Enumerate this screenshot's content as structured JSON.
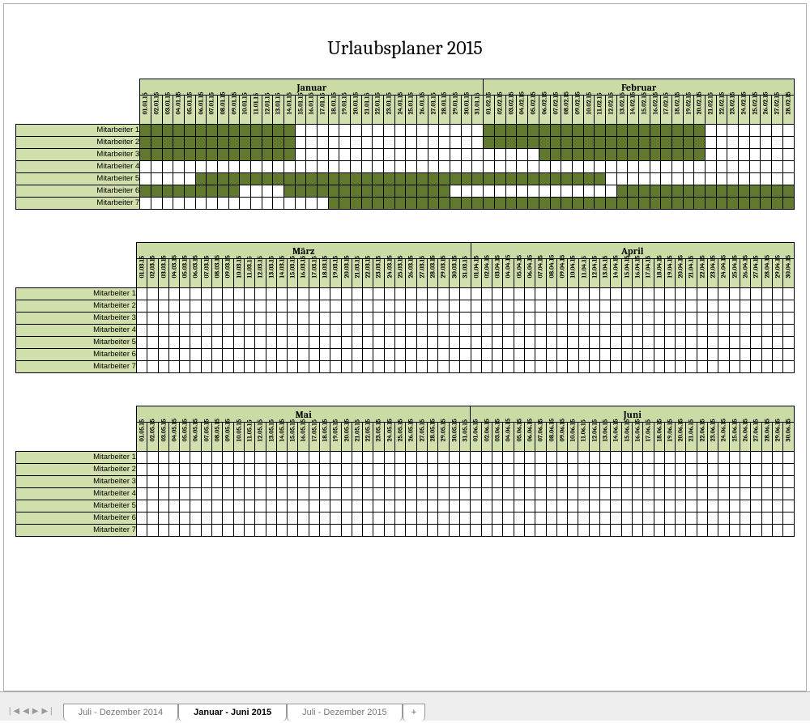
{
  "title": "Urlaubsplaner 2015",
  "employees": [
    "Mitarbeiter 1",
    "Mitarbeiter 2",
    "Mitarbeiter 3",
    "Mitarbeiter 4",
    "Mitarbeiter 5",
    "Mitarbeiter 6",
    "Mitarbeiter 7"
  ],
  "blocks": [
    {
      "months": [
        {
          "name": "Januar",
          "mm": "01",
          "yy": "15",
          "days": 31
        },
        {
          "name": "Februar",
          "mm": "02",
          "yy": "15",
          "days": 28
        }
      ],
      "filled": {
        "0": [
          1,
          2,
          3,
          4,
          5,
          6,
          7,
          8,
          9,
          10,
          11,
          12,
          13,
          14,
          32,
          33,
          34,
          35,
          36,
          37,
          38,
          39,
          40,
          41,
          42,
          43,
          44,
          45,
          46,
          47,
          48,
          49,
          50,
          51
        ],
        "1": [
          1,
          2,
          3,
          4,
          5,
          6,
          7,
          8,
          9,
          10,
          11,
          12,
          13,
          14,
          32,
          33,
          34,
          35,
          36,
          37,
          38,
          39,
          40,
          41,
          42,
          43,
          44,
          45,
          46,
          47,
          48,
          49,
          50,
          51
        ],
        "2": [
          1,
          2,
          3,
          4,
          5,
          6,
          7,
          8,
          9,
          10,
          11,
          12,
          13,
          14,
          37,
          38,
          39,
          40,
          41,
          42,
          43,
          44,
          45,
          46,
          47,
          48,
          49,
          50,
          51
        ],
        "3": [],
        "4": [
          6,
          7,
          8,
          9,
          10,
          11,
          12,
          13,
          14,
          15,
          16,
          17,
          18,
          19,
          20,
          21,
          22,
          23,
          24,
          25,
          26,
          27,
          28,
          29,
          30,
          31,
          32,
          33,
          34,
          35,
          36,
          37,
          38,
          39,
          40,
          41,
          42
        ],
        "5": [
          1,
          2,
          3,
          4,
          5,
          6,
          7,
          8,
          9,
          14,
          15,
          16,
          17,
          18,
          19,
          20,
          21,
          22,
          23,
          24,
          25,
          26,
          27,
          28,
          44,
          45,
          46,
          47,
          48,
          49,
          50,
          51,
          52,
          53,
          54,
          55,
          56,
          57,
          58,
          59
        ],
        "6": [
          18,
          19,
          20,
          21,
          22,
          23,
          24,
          25,
          26,
          27,
          28,
          29,
          30,
          31,
          32,
          33,
          34,
          35,
          36,
          37,
          38,
          39,
          40,
          41,
          42,
          43,
          44,
          45,
          46,
          47,
          48,
          49,
          50,
          51,
          52,
          53,
          54,
          55,
          56,
          57,
          58,
          59
        ]
      }
    },
    {
      "months": [
        {
          "name": "März",
          "mm": "03",
          "yy": "15",
          "days": 31
        },
        {
          "name": "April",
          "mm": "04",
          "yy": "15",
          "days": 30
        }
      ],
      "filled": {}
    },
    {
      "months": [
        {
          "name": "Mai",
          "mm": "05",
          "yy": "15",
          "days": 31
        },
        {
          "name": "Juni",
          "mm": "06",
          "yy": "15",
          "days": 30
        }
      ],
      "filled": {}
    }
  ],
  "tabs": {
    "items": [
      {
        "label": "Juli - Dezember 2014",
        "active": false
      },
      {
        "label": "Januar - Juni 2015",
        "active": true
      },
      {
        "label": "Juli - Dezember 2015",
        "active": false
      }
    ],
    "add": "+"
  },
  "nav_icons": [
    "first",
    "prev",
    "next",
    "last"
  ]
}
